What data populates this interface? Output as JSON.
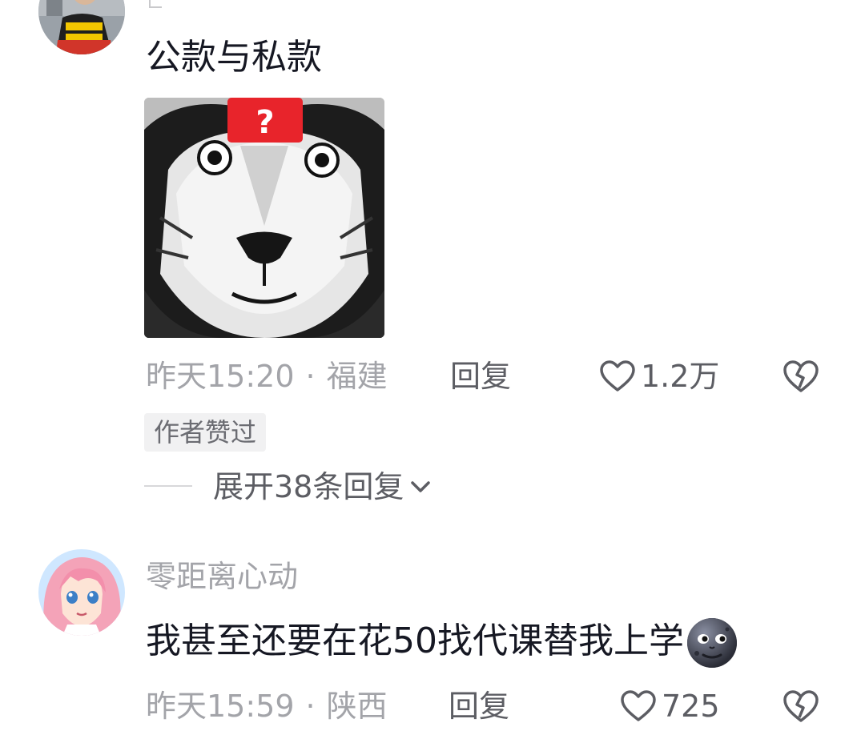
{
  "comments": [
    {
      "text": "公款与私款",
      "sticker_icon": "shocked-lion-sticker",
      "sticker_label": "?",
      "time": "昨天15:20",
      "separator": "·",
      "location": "福建",
      "reply_label": "回复",
      "likes": "1.2万",
      "badge": "作者赞过",
      "expand_label": "展开38条回复"
    },
    {
      "username": "零距离心动",
      "text": "我甚至还要在花50找代课替我上学",
      "emoji_icon": "smirking-moon-emoji",
      "time": "昨天15:59",
      "separator": "·",
      "location": "陕西",
      "reply_label": "回复",
      "likes": "725"
    }
  ],
  "colors": {
    "text_primary": "#161823",
    "text_secondary": "#a3a4a9",
    "action_gray": "#5c5d63",
    "sticker_badge": "#e8242b"
  }
}
